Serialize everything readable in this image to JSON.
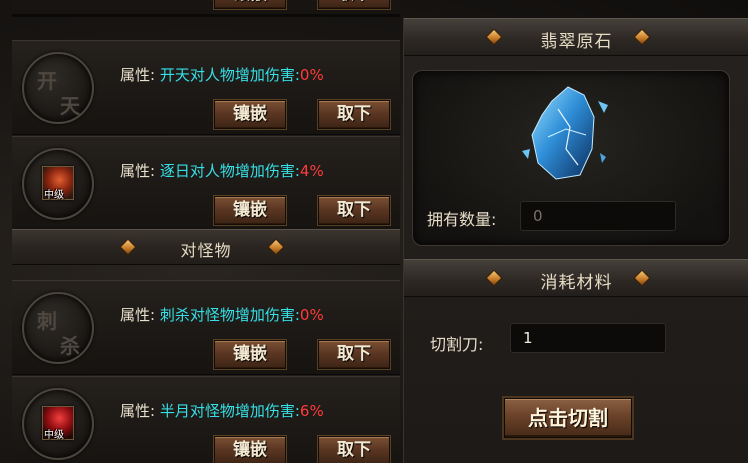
{
  "left_list": {
    "top_buttons": {
      "embed_label": "镶嵌",
      "remove_label": "取下"
    },
    "pvp_items": [
      {
        "name_chars": [
          "开",
          "天"
        ],
        "attr_label": "属性:",
        "attr_text": "开天对人物增加伤害:",
        "attr_value": "0%",
        "embed_label": "镶嵌",
        "remove_label": "取下"
      },
      {
        "gem_color": "#e06030",
        "gem_tag": "中级",
        "attr_label": "属性:",
        "attr_text": "逐日对人物增加伤害:",
        "attr_value": "4%",
        "embed_label": "镶嵌",
        "remove_label": "取下"
      }
    ],
    "pve_header": "对怪物",
    "pve_items": [
      {
        "name_chars": [
          "刺",
          "杀"
        ],
        "attr_label": "属性:",
        "attr_text": "刺杀对怪物增加伤害:",
        "attr_value": "0%",
        "embed_label": "镶嵌",
        "remove_label": "取下"
      },
      {
        "gem_color": "#f04040",
        "gem_tag": "中级",
        "attr_label": "属性:",
        "attr_text": "半月对怪物增加伤害:",
        "attr_value": "6%",
        "embed_label": "镶嵌",
        "remove_label": "取下"
      }
    ]
  },
  "right_panel": {
    "stone_header": "翡翠原石",
    "stone_icon": "jade-raw-stone-icon",
    "owned_label": "拥有数量:",
    "owned_value": "0",
    "consume_header": "消耗材料",
    "knife_label": "切割刀:",
    "knife_value": "1",
    "cut_button": "点击切割"
  },
  "colors": {
    "attr_text": "#35e0e6",
    "attr_value": "#ff3b3b",
    "header_diamond": "#d08a30"
  }
}
